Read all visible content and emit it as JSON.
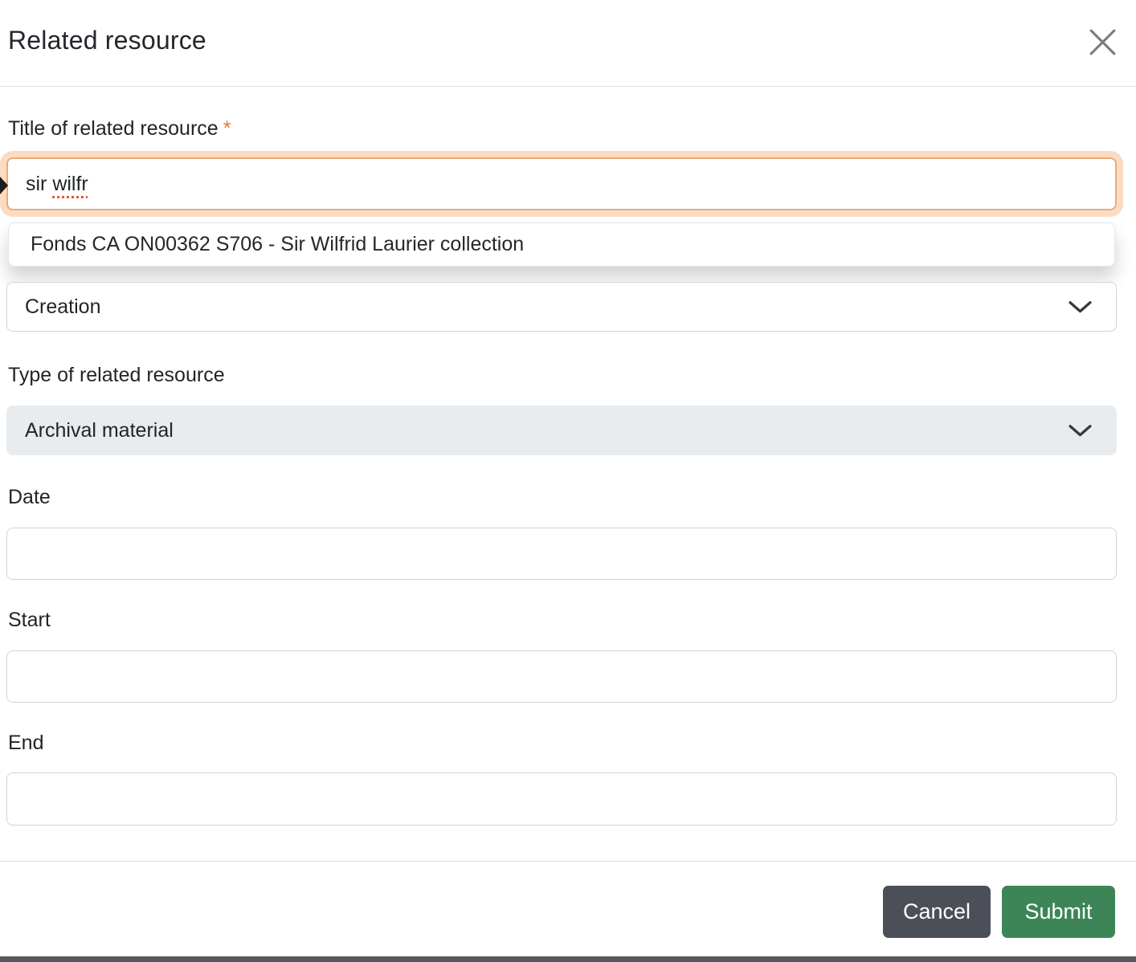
{
  "dialog": {
    "title": "Related resource"
  },
  "fields": {
    "title": {
      "label": "Title of related resource",
      "required_marker": "*",
      "value_before": "sir ",
      "value_misspelled": "wilfr",
      "suggestion": "Fonds CA ON00362 S706 - Sir Wilfrid Laurier collection"
    },
    "relation_type": {
      "value": "Creation"
    },
    "resource_type": {
      "label": "Type of related resource",
      "value": "Archival material"
    },
    "date": {
      "label": "Date",
      "value": ""
    },
    "start": {
      "label": "Start",
      "value": ""
    },
    "end": {
      "label": "End",
      "value": ""
    }
  },
  "footer": {
    "cancel_label": "Cancel",
    "submit_label": "Submit"
  },
  "icons": {
    "close": "close-icon",
    "chevron": "chevron-down-icon"
  },
  "colors": {
    "accent_orange": "#e8743a",
    "focus_ring": "#fbdcc2",
    "focus_border": "#edaa77",
    "submit_green": "#3d8557",
    "cancel_gray": "#4b4f58",
    "select_gray_bg": "#e9ecef",
    "input_border": "#ced4da",
    "divider": "#dee2e6"
  }
}
